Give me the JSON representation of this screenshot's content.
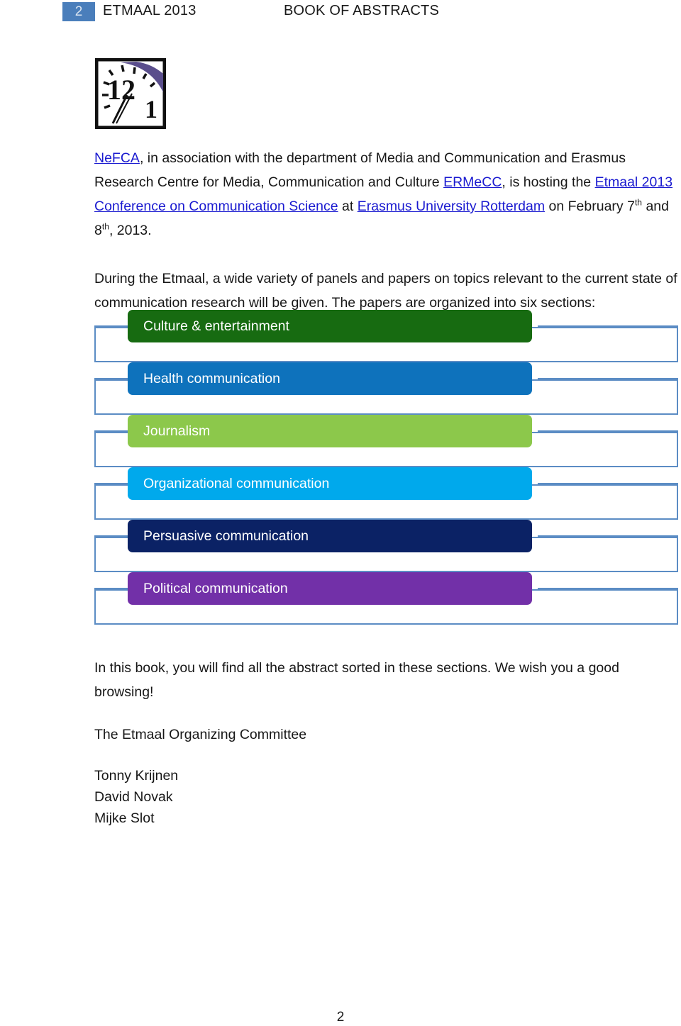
{
  "header": {
    "page_number": "2",
    "title_left": "ETMAAL 2013",
    "title_right": "BOOK OF ABSTRACTS",
    "box_color": "#4a7ebb"
  },
  "logo": {
    "name": "etmaal-clock-logo",
    "numeral_twelve": "12",
    "numeral_one": "1",
    "arc_color": "#5a4e8c"
  },
  "intro": {
    "link_nefca": "NeFCA",
    "text_1": ", in association with the department of Media and Communication and Erasmus Research Centre for Media, Communication and Culture ",
    "link_ermecc": "ERMeCC",
    "text_2": ", is hosting the ",
    "link_etmaal": "Etmaal 2013 Conference on Communication Science",
    "text_3": " at ",
    "link_eur": "Erasmus University Rotterdam",
    "text_4": " on February 7",
    "sup_1": "th",
    "text_5": " and 8",
    "sup_2": "th",
    "text_6": ", 2013."
  },
  "paragraph_sections": {
    "text": "During the Etmaal, a wide variety of panels and papers on topics relevant to the current state of communication research will be given. The papers are organized into six sections:"
  },
  "diagram": {
    "outline_color": "#5b8cc4",
    "items": [
      {
        "label": "Culture & entertainment",
        "color": "#176b11"
      },
      {
        "label": "Health communication",
        "color": "#0e72bc"
      },
      {
        "label": "Journalism",
        "color": "#8cc84b"
      },
      {
        "label": "Organizational communication",
        "color": "#00a9ec"
      },
      {
        "label": "Persuasive communication",
        "color": "#0b2265"
      },
      {
        "label": "Political communication",
        "color": "#7230a8"
      }
    ]
  },
  "closing": {
    "browsing_text": "In this book, you will find all the abstract sorted in these sections. We wish you a good browsing!",
    "committee": "The Etmaal Organizing Committee",
    "names": [
      "Tonny Krijnen",
      "David Novak",
      "Mijke Slot"
    ]
  },
  "footer": {
    "page_number": "2"
  }
}
